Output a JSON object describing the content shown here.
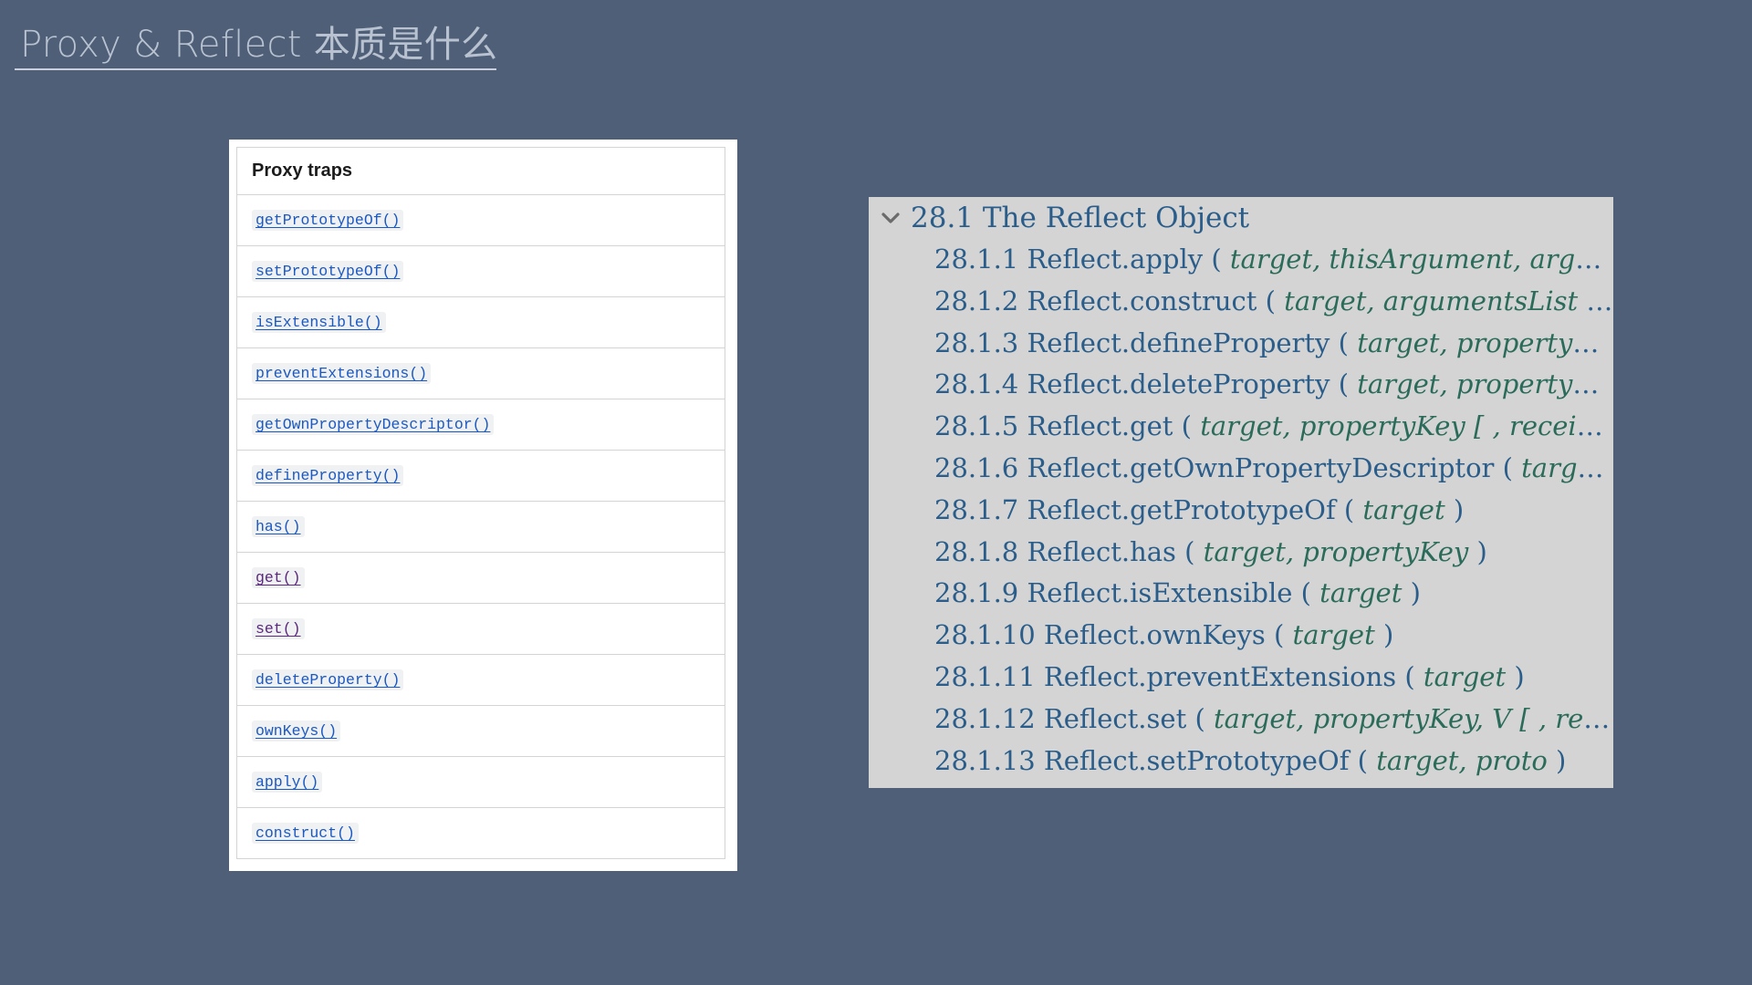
{
  "slide": {
    "title": "Proxy & Reflect 本质是什么"
  },
  "proxy_traps": {
    "header": "Proxy traps",
    "items": [
      {
        "label": "getPrototypeOf()",
        "visited": false
      },
      {
        "label": "setPrototypeOf()",
        "visited": false
      },
      {
        "label": "isExtensible()",
        "visited": false
      },
      {
        "label": "preventExtensions()",
        "visited": false
      },
      {
        "label": "getOwnPropertyDescriptor()",
        "visited": false
      },
      {
        "label": "defineProperty()",
        "visited": false
      },
      {
        "label": "has()",
        "visited": false
      },
      {
        "label": "get()",
        "visited": true
      },
      {
        "label": "set()",
        "visited": true
      },
      {
        "label": "deleteProperty()",
        "visited": false
      },
      {
        "label": "ownKeys()",
        "visited": false
      },
      {
        "label": "apply()",
        "visited": false
      },
      {
        "label": "construct()",
        "visited": false
      }
    ]
  },
  "reflect_toc": {
    "header": "28.1 The Reflect Object",
    "items": [
      {
        "name": "28.1.1 Reflect.apply (",
        "params": " target, thisArgument, argumentsList ",
        "close": ")"
      },
      {
        "name": "28.1.2 Reflect.construct (",
        "params": " target, argumentsList [ , newTarget ] ",
        "close": ")"
      },
      {
        "name": "28.1.3 Reflect.defineProperty (",
        "params": " target, propertyKey, attributes ",
        "close": ")"
      },
      {
        "name": "28.1.4 Reflect.deleteProperty (",
        "params": " target, propertyKey ",
        "close": ")"
      },
      {
        "name": "28.1.5 Reflect.get (",
        "params": " target, propertyKey [ , receiver ] ",
        "close": ")"
      },
      {
        "name": "28.1.6 Reflect.getOwnPropertyDescriptor (",
        "params": " target, propertyKey ",
        "close": ")"
      },
      {
        "name": "28.1.7 Reflect.getPrototypeOf (",
        "params": " target ",
        "close": ")"
      },
      {
        "name": "28.1.8 Reflect.has (",
        "params": " target, propertyKey ",
        "close": ")"
      },
      {
        "name": "28.1.9 Reflect.isExtensible (",
        "params": " target ",
        "close": ")"
      },
      {
        "name": "28.1.10 Reflect.ownKeys (",
        "params": " target ",
        "close": ")"
      },
      {
        "name": "28.1.11 Reflect.preventExtensions (",
        "params": " target ",
        "close": ")"
      },
      {
        "name": "28.1.12 Reflect.set (",
        "params": " target, propertyKey, V [ , receiver ] ",
        "close": ")"
      },
      {
        "name": "28.1.13 Reflect.setPrototypeOf (",
        "params": " target, proto ",
        "close": ")"
      }
    ]
  },
  "colors": {
    "background": "#4f5f78",
    "link": "#1a58c2",
    "link_visited": "#5a287c",
    "toc_text": "#2a5d8a",
    "toc_params": "#2b6b5a"
  }
}
